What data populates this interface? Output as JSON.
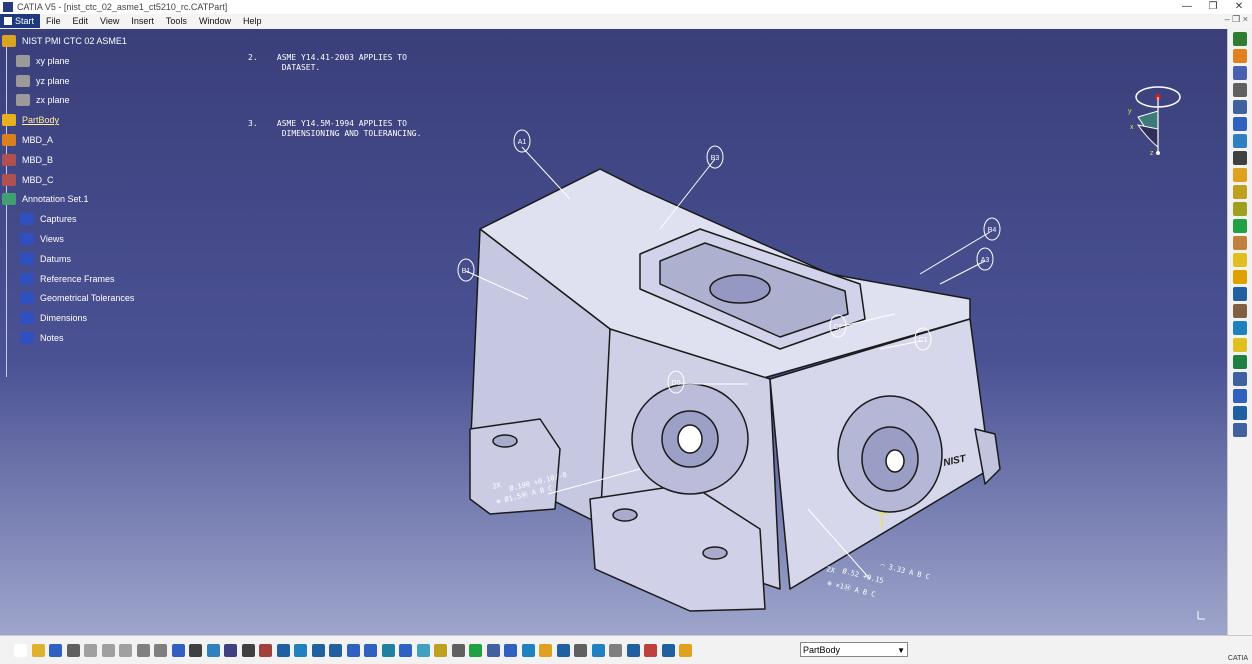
{
  "window": {
    "title": "CATIA V5 - [nist_ctc_02_asme1_ct5210_rc.CATPart]",
    "controls": [
      "—",
      "❐",
      "✕"
    ]
  },
  "menu": {
    "start": "Start",
    "items": [
      "File",
      "Edit",
      "View",
      "Insert",
      "Tools",
      "Window",
      "Help"
    ],
    "doc_controls": "–  ❐  ×"
  },
  "tree": [
    {
      "label": "NIST PMI CTC 02 ASME1",
      "icon": "part-root-icon",
      "color": "#d9a520"
    },
    {
      "label": "xy plane",
      "icon": "plane-icon",
      "color": "#9a9a9a"
    },
    {
      "label": "yz plane",
      "icon": "plane-icon",
      "color": "#9a9a9a"
    },
    {
      "label": "zx plane",
      "icon": "plane-icon",
      "color": "#9a9a9a"
    },
    {
      "label": "PartBody",
      "icon": "gear-body-icon",
      "color": "#e8b020",
      "selected": true
    },
    {
      "label": "MBD_A",
      "icon": "geometrical-set-icon",
      "color": "#d88020"
    },
    {
      "label": "MBD_B",
      "icon": "geometrical-set-icon",
      "color": "#b05050"
    },
    {
      "label": "MBD_C",
      "icon": "geometrical-set-icon",
      "color": "#b05050"
    },
    {
      "label": "Annotation Set.1",
      "icon": "annotation-set-icon",
      "color": "#40a070"
    },
    {
      "label": "Captures",
      "icon": "captures-icon",
      "color": "#3050c0"
    },
    {
      "label": "Views",
      "icon": "views-icon",
      "color": "#3050c0"
    },
    {
      "label": "Datums",
      "icon": "datums-icon",
      "color": "#3050c0"
    },
    {
      "label": "Reference Frames",
      "icon": "reference-frames-icon",
      "color": "#3050c0"
    },
    {
      "label": "Geometrical Tolerances",
      "icon": "geometrical-tolerances-icon",
      "color": "#3050c0"
    },
    {
      "label": "Dimensions",
      "icon": "dimensions-icon",
      "color": "#3050c0"
    },
    {
      "label": "Notes",
      "icon": "notes-icon",
      "color": "#3050c0"
    }
  ],
  "notes": [
    "2.    ASME Y14.41-2003 APPLIES TO\n       DATASET.",
    "3.    ASME Y14.5M-1994 APPLIES TO\n       DIMENSIONING AND TOLERANCING."
  ],
  "annotations": {
    "datum_targets": [
      "A1",
      "B3",
      "B1",
      "B4",
      "A3",
      "C2",
      "C1",
      "D0"
    ],
    "dim_left": {
      "count": "2X",
      "value": "Ø.190 +0.10/-0",
      "fcf": "⊕ Ø1.5Ⓜ A B C"
    },
    "dim_right": {
      "count": "2X",
      "value": "Ø.52 +0.15",
      "fcf": "⊕ ×1Ⓜ A B C"
    },
    "profile_fcf": "⌒ 3.33 A B C",
    "logo": "NIST"
  },
  "compass_axes": {
    "y": "y",
    "x": "x",
    "z": "z"
  },
  "toolbar": {
    "part_selector": "PartBody",
    "brand": "CATIA"
  },
  "colors": {
    "background_top": "#3a3f7a",
    "background_bottom": "#9fa6cc",
    "part_face": "#d8d9ee",
    "part_edge": "#1a1a1a",
    "annotation": "#ffffff"
  }
}
